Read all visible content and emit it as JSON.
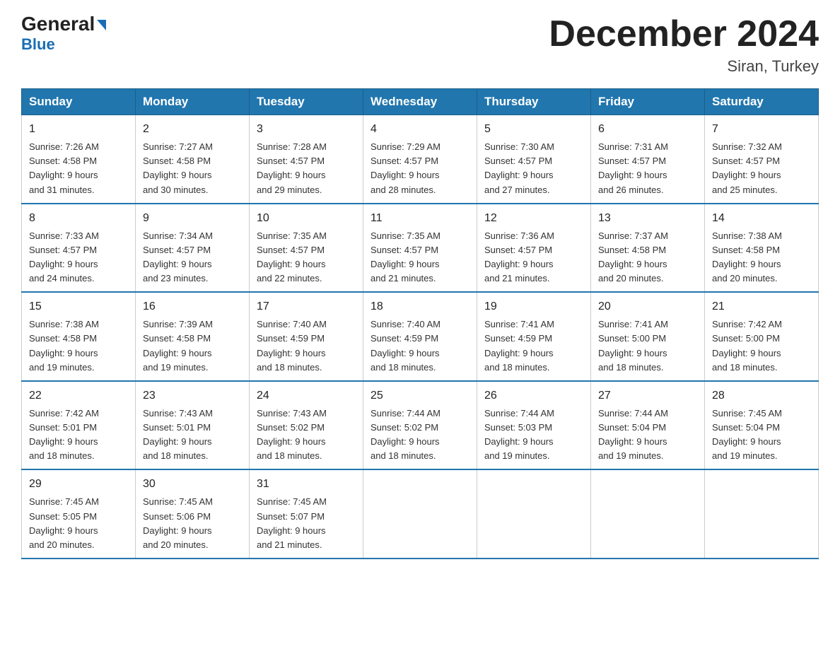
{
  "header": {
    "logo_general": "General",
    "logo_blue": "Blue",
    "month_title": "December 2024",
    "location": "Siran, Turkey"
  },
  "days_of_week": [
    "Sunday",
    "Monday",
    "Tuesday",
    "Wednesday",
    "Thursday",
    "Friday",
    "Saturday"
  ],
  "weeks": [
    [
      {
        "day": "1",
        "sunrise": "7:26 AM",
        "sunset": "4:58 PM",
        "daylight": "9 hours and 31 minutes."
      },
      {
        "day": "2",
        "sunrise": "7:27 AM",
        "sunset": "4:58 PM",
        "daylight": "9 hours and 30 minutes."
      },
      {
        "day": "3",
        "sunrise": "7:28 AM",
        "sunset": "4:57 PM",
        "daylight": "9 hours and 29 minutes."
      },
      {
        "day": "4",
        "sunrise": "7:29 AM",
        "sunset": "4:57 PM",
        "daylight": "9 hours and 28 minutes."
      },
      {
        "day": "5",
        "sunrise": "7:30 AM",
        "sunset": "4:57 PM",
        "daylight": "9 hours and 27 minutes."
      },
      {
        "day": "6",
        "sunrise": "7:31 AM",
        "sunset": "4:57 PM",
        "daylight": "9 hours and 26 minutes."
      },
      {
        "day": "7",
        "sunrise": "7:32 AM",
        "sunset": "4:57 PM",
        "daylight": "9 hours and 25 minutes."
      }
    ],
    [
      {
        "day": "8",
        "sunrise": "7:33 AM",
        "sunset": "4:57 PM",
        "daylight": "9 hours and 24 minutes."
      },
      {
        "day": "9",
        "sunrise": "7:34 AM",
        "sunset": "4:57 PM",
        "daylight": "9 hours and 23 minutes."
      },
      {
        "day": "10",
        "sunrise": "7:35 AM",
        "sunset": "4:57 PM",
        "daylight": "9 hours and 22 minutes."
      },
      {
        "day": "11",
        "sunrise": "7:35 AM",
        "sunset": "4:57 PM",
        "daylight": "9 hours and 21 minutes."
      },
      {
        "day": "12",
        "sunrise": "7:36 AM",
        "sunset": "4:57 PM",
        "daylight": "9 hours and 21 minutes."
      },
      {
        "day": "13",
        "sunrise": "7:37 AM",
        "sunset": "4:58 PM",
        "daylight": "9 hours and 20 minutes."
      },
      {
        "day": "14",
        "sunrise": "7:38 AM",
        "sunset": "4:58 PM",
        "daylight": "9 hours and 20 minutes."
      }
    ],
    [
      {
        "day": "15",
        "sunrise": "7:38 AM",
        "sunset": "4:58 PM",
        "daylight": "9 hours and 19 minutes."
      },
      {
        "day": "16",
        "sunrise": "7:39 AM",
        "sunset": "4:58 PM",
        "daylight": "9 hours and 19 minutes."
      },
      {
        "day": "17",
        "sunrise": "7:40 AM",
        "sunset": "4:59 PM",
        "daylight": "9 hours and 18 minutes."
      },
      {
        "day": "18",
        "sunrise": "7:40 AM",
        "sunset": "4:59 PM",
        "daylight": "9 hours and 18 minutes."
      },
      {
        "day": "19",
        "sunrise": "7:41 AM",
        "sunset": "4:59 PM",
        "daylight": "9 hours and 18 minutes."
      },
      {
        "day": "20",
        "sunrise": "7:41 AM",
        "sunset": "5:00 PM",
        "daylight": "9 hours and 18 minutes."
      },
      {
        "day": "21",
        "sunrise": "7:42 AM",
        "sunset": "5:00 PM",
        "daylight": "9 hours and 18 minutes."
      }
    ],
    [
      {
        "day": "22",
        "sunrise": "7:42 AM",
        "sunset": "5:01 PM",
        "daylight": "9 hours and 18 minutes."
      },
      {
        "day": "23",
        "sunrise": "7:43 AM",
        "sunset": "5:01 PM",
        "daylight": "9 hours and 18 minutes."
      },
      {
        "day": "24",
        "sunrise": "7:43 AM",
        "sunset": "5:02 PM",
        "daylight": "9 hours and 18 minutes."
      },
      {
        "day": "25",
        "sunrise": "7:44 AM",
        "sunset": "5:02 PM",
        "daylight": "9 hours and 18 minutes."
      },
      {
        "day": "26",
        "sunrise": "7:44 AM",
        "sunset": "5:03 PM",
        "daylight": "9 hours and 19 minutes."
      },
      {
        "day": "27",
        "sunrise": "7:44 AM",
        "sunset": "5:04 PM",
        "daylight": "9 hours and 19 minutes."
      },
      {
        "day": "28",
        "sunrise": "7:45 AM",
        "sunset": "5:04 PM",
        "daylight": "9 hours and 19 minutes."
      }
    ],
    [
      {
        "day": "29",
        "sunrise": "7:45 AM",
        "sunset": "5:05 PM",
        "daylight": "9 hours and 20 minutes."
      },
      {
        "day": "30",
        "sunrise": "7:45 AM",
        "sunset": "5:06 PM",
        "daylight": "9 hours and 20 minutes."
      },
      {
        "day": "31",
        "sunrise": "7:45 AM",
        "sunset": "5:07 PM",
        "daylight": "9 hours and 21 minutes."
      },
      null,
      null,
      null,
      null
    ]
  ],
  "labels": {
    "sunrise": "Sunrise:",
    "sunset": "Sunset:",
    "daylight": "Daylight:"
  }
}
